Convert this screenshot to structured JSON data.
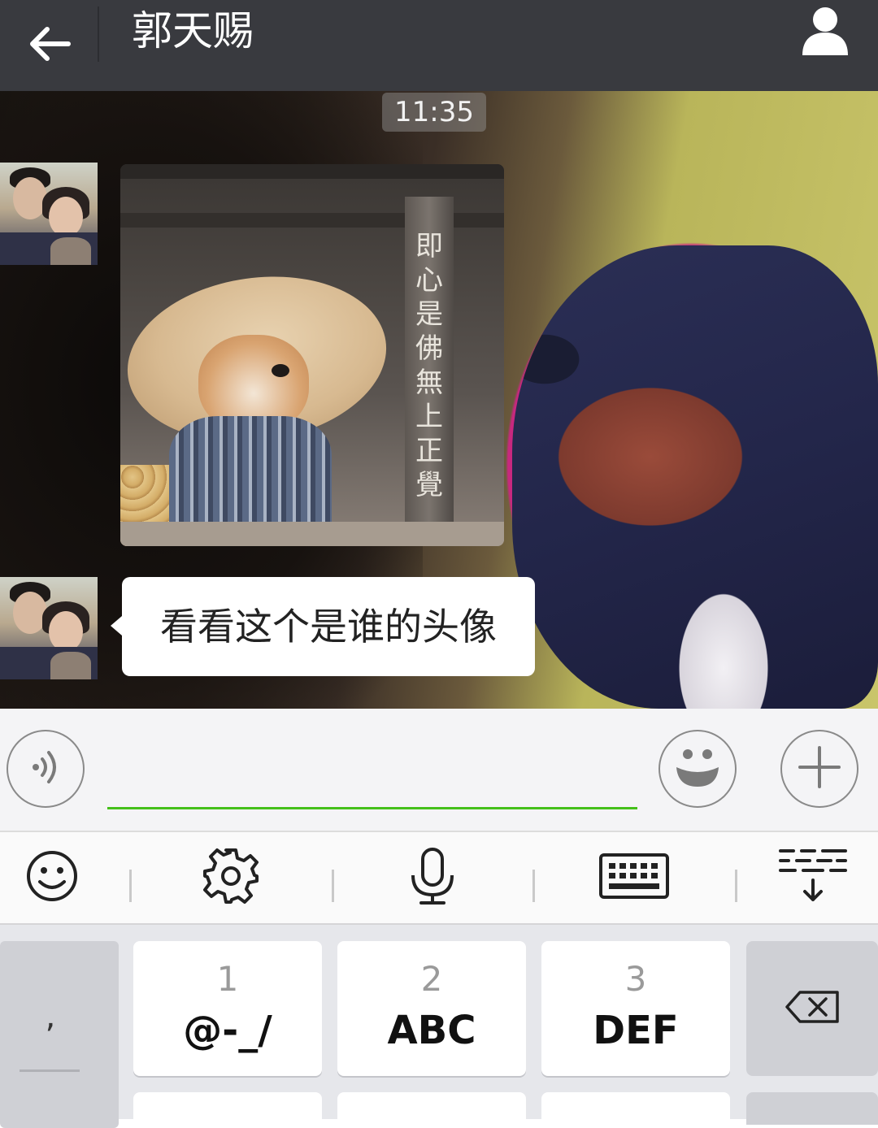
{
  "header": {
    "title": "郭天赐",
    "back_icon": "arrow-left-icon",
    "contact_icon": "person-icon"
  },
  "chat": {
    "timestamp": "11:35",
    "messages": [
      {
        "type": "image",
        "image_text": "即心是佛無上正覺"
      },
      {
        "type": "text",
        "text": "看看这个是谁的头像"
      }
    ]
  },
  "input_bar": {
    "value": "",
    "voice_icon": "voice-icon",
    "emoji_icon": "emoji-icon",
    "plus_icon": "plus-icon"
  },
  "keyboard_toolbar": {
    "icons": [
      "smiley-icon",
      "gear-icon",
      "microphone-icon",
      "keyboard-icon",
      "hide-keyboard-icon"
    ]
  },
  "keyboard": {
    "side_key": ",",
    "keys": [
      {
        "num": "1",
        "letters": "@-_/"
      },
      {
        "num": "2",
        "letters": "ABC"
      },
      {
        "num": "3",
        "letters": "DEF"
      }
    ],
    "delete_icon": "backspace-icon"
  },
  "colors": {
    "topbar": "#393a3f",
    "input_underline": "#45c01a",
    "bubble": "#ffffff",
    "keyboard_bg": "#e6e7eb"
  }
}
